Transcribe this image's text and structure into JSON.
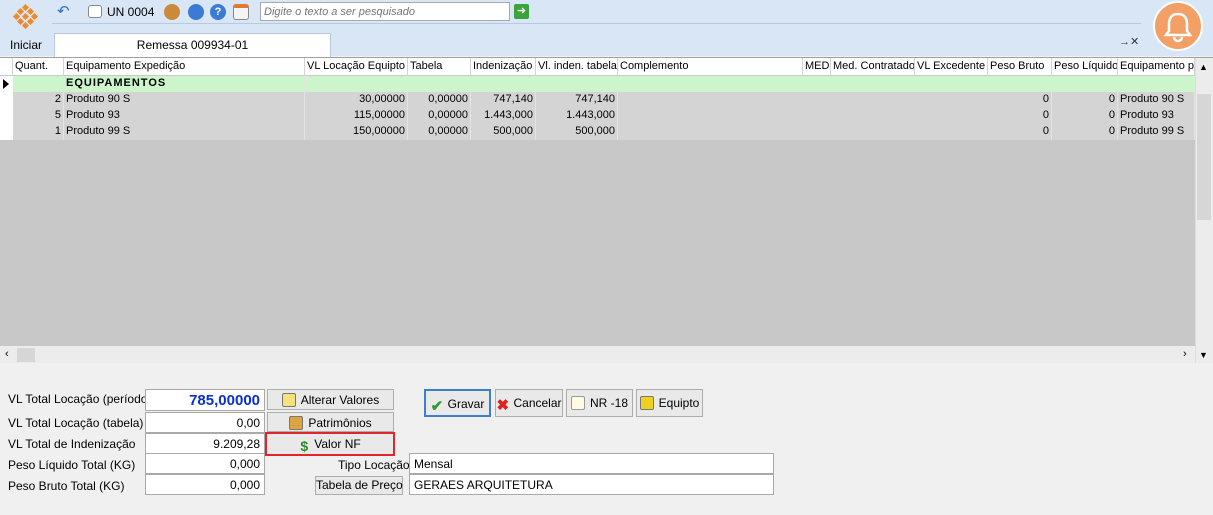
{
  "app": {
    "start_label": "Iniciar",
    "unit_label": "UN 0004"
  },
  "search": {
    "placeholder": "Digite o texto a ser pesquisado"
  },
  "tab": {
    "label": "Remessa 009934-01",
    "pin_label": "→✕"
  },
  "table": {
    "columns": [
      "Quant.",
      "Equipamento Expedição",
      "VL Locação Equipto",
      "Tabela",
      "Indenização",
      "Vl. inden. tabela",
      "Complemento",
      "MED",
      "Med. Contratado",
      "VL Excedente",
      "Peso Bruto",
      "Peso Líquido",
      "Equipamento pr"
    ],
    "group_label": "EQUIPAMENTOS",
    "rows": [
      {
        "qty": "2",
        "equip": "Produto 90 S",
        "vl_loc": "30,00000",
        "tabela": "0,00000",
        "indeniz": "747,140",
        "vl_inden": "747,140",
        "peso_bruto": "0",
        "peso_liq": "0",
        "equip_pr": "Produto 90 S"
      },
      {
        "qty": "5",
        "equip": "Produto 93",
        "vl_loc": "115,00000",
        "tabela": "0,00000",
        "indeniz": "1.443,000",
        "vl_inden": "1.443,000",
        "peso_bruto": "0",
        "peso_liq": "0",
        "equip_pr": "Produto 93"
      },
      {
        "qty": "1",
        "equip": "Produto 99 S",
        "vl_loc": "150,00000",
        "tabela": "0,00000",
        "indeniz": "500,000",
        "vl_inden": "500,000",
        "peso_bruto": "0",
        "peso_liq": "0",
        "equip_pr": "Produto 99 S"
      }
    ]
  },
  "totals": {
    "vl_loc_periodo_label": "VL Total Locação (período)",
    "vl_loc_periodo": "785,00000",
    "vl_loc_tabela_label": "VL Total Locação (tabela)",
    "vl_loc_tabela": "0,00",
    "vl_indeniz_label": "VL Total de Indenização",
    "vl_indeniz": "9.209,28",
    "peso_liq_label": "Peso Líquido Total (KG)",
    "peso_liq": "0,000",
    "peso_bruto_label": "Peso Bruto Total (KG)",
    "peso_bruto": "0,000"
  },
  "buttons": {
    "alterar": "Alterar Valores",
    "patrimonios": "Patrimônios",
    "valor_nf": "Valor NF",
    "gravar": "Gravar",
    "cancelar": "Cancelar",
    "nr18": "NR -18",
    "equipto": "Equipto",
    "tabela_preco": "Tabela de Preço"
  },
  "fields": {
    "tipo_locacao_label": "Tipo Locação",
    "tipo_locacao": "Mensal",
    "tabela_preco_value": "GERAES ARQUITETURA"
  },
  "colors": {
    "highlight": "#e0262b",
    "total_value": "#0a2fd1",
    "accent": "#f2a066"
  }
}
